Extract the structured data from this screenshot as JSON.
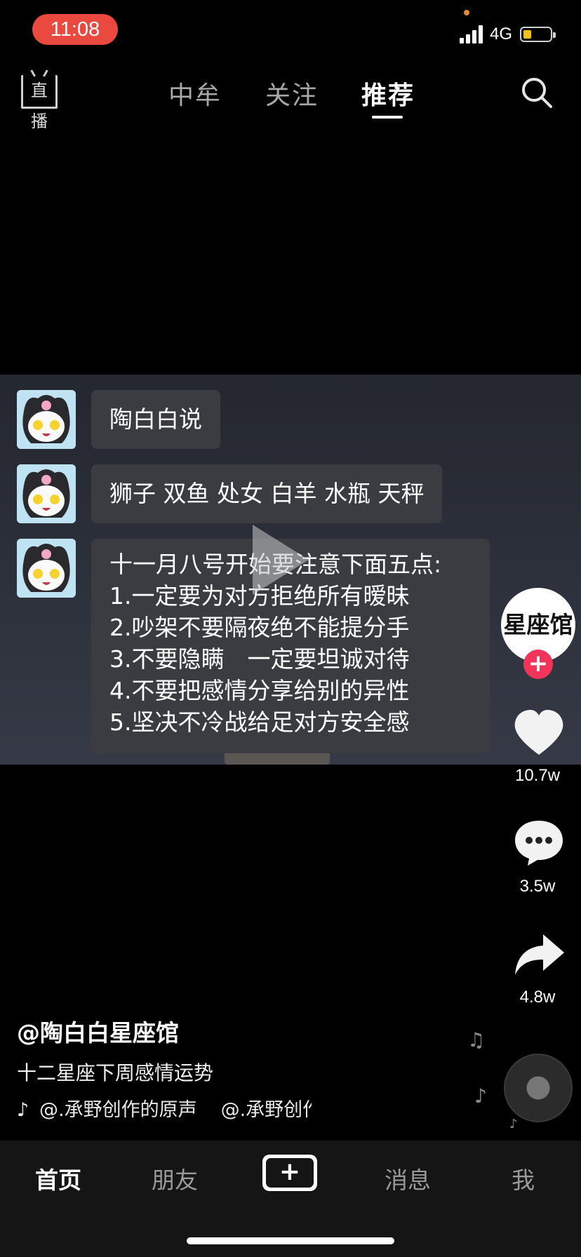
{
  "status_bar": {
    "time": "11:08",
    "network": "4G",
    "battery_percent": 0.3
  },
  "top_nav": {
    "live_label": "直播",
    "tabs": [
      {
        "label": "中牟",
        "active": false
      },
      {
        "label": "关注",
        "active": false
      },
      {
        "label": "推荐",
        "active": true
      }
    ]
  },
  "video": {
    "messages": [
      {
        "text": "陶白白说"
      },
      {
        "text": "狮子 双鱼 处女 白羊 水瓶 天秤"
      },
      {
        "lines": [
          "十一月八号开始要注意下面五点:",
          "1.一定要为对方拒绝所有暧昧",
          "2.吵架不要隔夜绝不能提分手",
          "3.不要隐瞒　一定要坦诚对待",
          "4.不要把感情分享给别的异性",
          "5.坚决不冷战给足对方安全感"
        ]
      }
    ]
  },
  "right_rail": {
    "creator_badge": "星座馆",
    "follow_symbol": "+",
    "likes": "10.7w",
    "comments": "3.5w",
    "shares": "4.8w"
  },
  "caption": {
    "author": "@陶白白星座馆",
    "description": "十二星座下周感情运势",
    "music_track": "@.承野创作的原声",
    "music_track_repeat": "@.承野创作的原声"
  },
  "tab_bar": {
    "items": [
      {
        "label": "首页",
        "active": true
      },
      {
        "label": "朋友",
        "active": false
      },
      {
        "label": "+",
        "active": false
      },
      {
        "label": "消息",
        "active": false
      },
      {
        "label": "我",
        "active": false
      }
    ]
  },
  "colors": {
    "accent": "#fe2c55",
    "cyan": "#25f4ee",
    "time_pill": "#e9493f",
    "battery": "#f2c21a"
  }
}
